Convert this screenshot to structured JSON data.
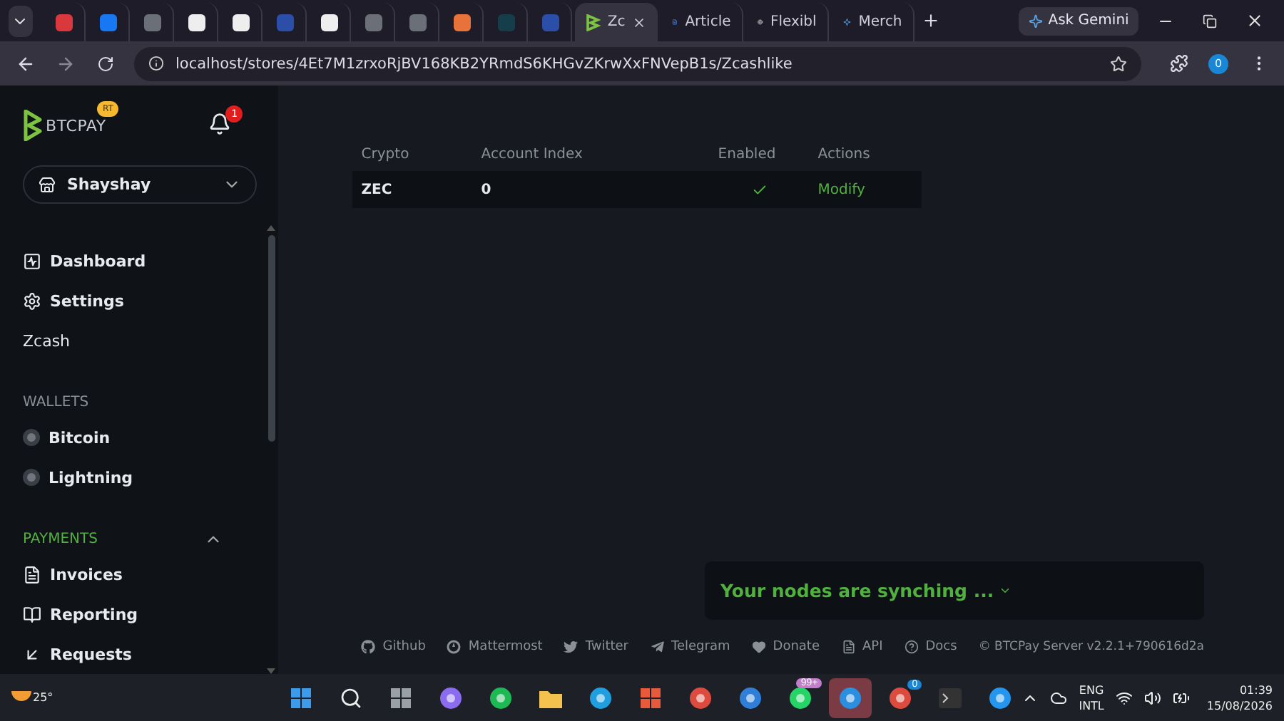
{
  "browser": {
    "tabs": [
      {
        "kind": "icon",
        "selected": false
      },
      {
        "kind": "icon",
        "selected": false
      },
      {
        "kind": "icon",
        "selected": false
      },
      {
        "kind": "icon",
        "selected": false
      },
      {
        "kind": "icon",
        "selected": false
      },
      {
        "kind": "icon",
        "selected": false
      },
      {
        "kind": "icon",
        "selected": false
      },
      {
        "kind": "icon",
        "selected": false
      },
      {
        "kind": "icon",
        "selected": false
      },
      {
        "kind": "icon",
        "selected": false
      },
      {
        "kind": "icon",
        "selected": false
      },
      {
        "kind": "icon",
        "selected": false
      },
      {
        "kind": "titled",
        "label": "Zc",
        "selected": true
      },
      {
        "kind": "titled",
        "label": "Article",
        "selected": false
      },
      {
        "kind": "titled",
        "label": "Flexibl",
        "selected": false
      },
      {
        "kind": "titled",
        "label": "Merch",
        "selected": false
      }
    ],
    "gemini": "Ask Gemini",
    "url": "localhost/stores/4Et7M1zrxoRjBV168KB2YRmdS6KHGvZKrwXxFNVepB1s/Zcashlike",
    "profile": "0"
  },
  "sidebar": {
    "logo": "BTCPAY",
    "logo_badge": "RT",
    "notifications": "1",
    "store": "Shayshay",
    "items": [
      {
        "kind": "link",
        "label": "Dashboard"
      },
      {
        "kind": "link",
        "label": "Settings"
      },
      {
        "kind": "text",
        "label": "Zcash"
      },
      {
        "kind": "section",
        "label": "WALLETS"
      },
      {
        "kind": "wallet",
        "label": "Bitcoin"
      },
      {
        "kind": "wallet",
        "label": "Lightning"
      },
      {
        "kind": "section",
        "label": "PAYMENTS",
        "expanded": true
      },
      {
        "kind": "link",
        "label": "Invoices"
      },
      {
        "kind": "link",
        "label": "Reporting"
      },
      {
        "kind": "link",
        "label": "Requests"
      }
    ]
  },
  "table": {
    "columns": [
      "Crypto",
      "Account Index",
      "Enabled",
      "Actions"
    ],
    "rows": [
      {
        "crypto": "ZEC",
        "account_index": "0",
        "enabled": true,
        "action": "Modify"
      }
    ]
  },
  "sync_notice": "Your nodes are synching ...",
  "footer": {
    "links": [
      "Github",
      "Mattermost",
      "Twitter",
      "Telegram",
      "Donate",
      "API",
      "Docs"
    ],
    "copyright": "© BTCPay Server v2.2.1+790616d2a"
  },
  "taskbar": {
    "weather": "25°",
    "apps": [
      {
        "selected": false
      },
      {
        "selected": false
      },
      {
        "selected": false
      },
      {
        "selected": false
      },
      {
        "selected": false
      },
      {
        "selected": false
      },
      {
        "selected": false
      },
      {
        "selected": false
      },
      {
        "selected": false
      },
      {
        "selected": false
      },
      {
        "selected": false,
        "badge": "99+"
      },
      {
        "selected": true
      },
      {
        "selected": false,
        "badge": "0"
      },
      {
        "selected": false
      },
      {
        "selected": false
      }
    ],
    "language": "ENG",
    "layout": "INTL",
    "time": "01:39",
    "date": "15/08/2026"
  }
}
